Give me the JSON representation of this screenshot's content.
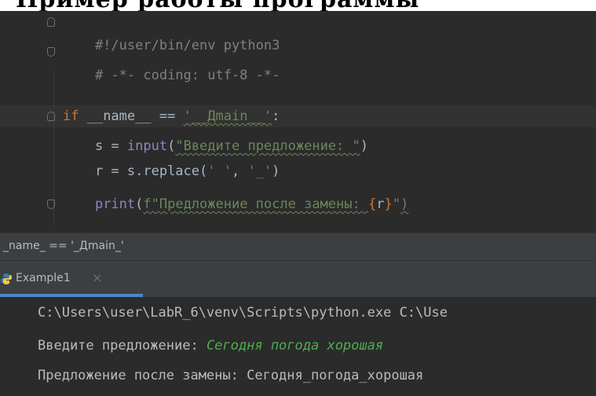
{
  "top_banner": {
    "text": "Пример работы программы"
  },
  "editor": {
    "lines": [
      {
        "text": "#!/user/bin/env python3"
      },
      {
        "text": "# -*- coding: utf-8 -*-"
      },
      {
        "text": ""
      },
      {
        "kw": "if",
        "name_expr": " __name__ == ",
        "str": "'__Дmain__'",
        "tail": ":"
      },
      {
        "indent": "    ",
        "pre": "s = ",
        "builtin": "input",
        "open": "(",
        "str": "\"Введите предложение: \"",
        "close": ")"
      },
      {
        "indent": "    ",
        "pre": "r = s.replace(",
        "str1": "' '",
        "sep": ", ",
        "str2": "'_'",
        "close": ")"
      },
      {
        "indent": "    ",
        "builtin": "print",
        "open": "(",
        "fstr_start": "f\"Предложение после замены: ",
        "brace_open": "{",
        "var": "r",
        "brace_close": "}",
        "fstr_end": "\"",
        "close": ")"
      }
    ]
  },
  "breadcrumb": {
    "text": "_name_ == '_Дmain_'"
  },
  "run_panel": {
    "tab_label": "Example1",
    "tab_close": "×",
    "colors": {
      "accent": "#4a88c7",
      "input": "#4caf50"
    }
  },
  "console": {
    "line1": "C:\\Users\\user\\LabR_6\\venv\\Scripts\\python.exe C:\\Use",
    "prompt": "Введите предложение: ",
    "input_value": "Сегодня погода хорошая",
    "result": "Предложение после замены: Сегодня_погода_хорошая"
  }
}
